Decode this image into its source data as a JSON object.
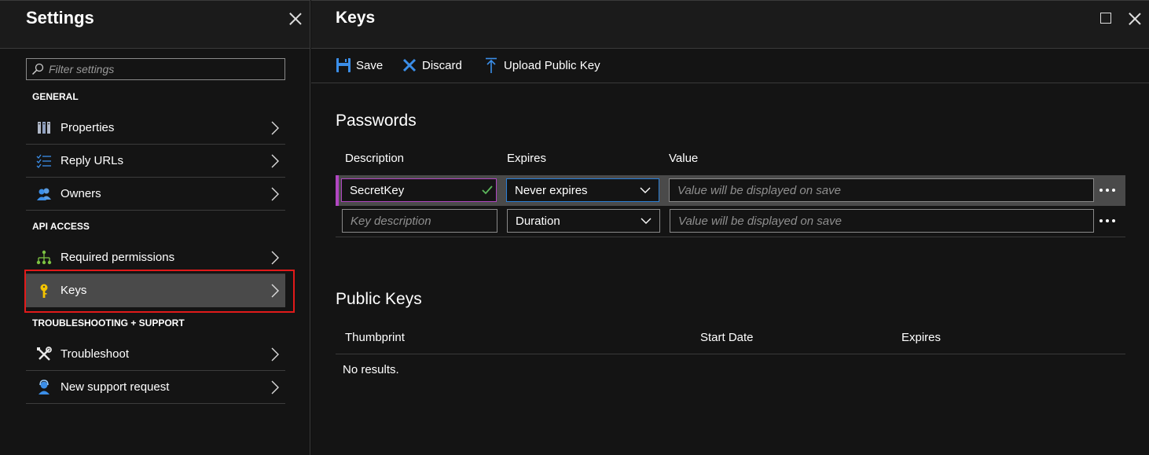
{
  "settings": {
    "title": "Settings",
    "filter_placeholder": "Filter settings",
    "sections": {
      "general": "GENERAL",
      "api_access": "API ACCESS",
      "troubleshooting": "TROUBLESHOOTING + SUPPORT"
    },
    "items": [
      {
        "label": "Properties",
        "icon": "properties-icon"
      },
      {
        "label": "Reply URLs",
        "icon": "list-icon"
      },
      {
        "label": "Owners",
        "icon": "users-icon"
      },
      {
        "label": "Required permissions",
        "icon": "hierarchy-icon"
      },
      {
        "label": "Keys",
        "icon": "key-icon",
        "selected": true
      },
      {
        "label": "Troubleshoot",
        "icon": "tools-icon"
      },
      {
        "label": "New support request",
        "icon": "support-person-icon"
      }
    ]
  },
  "keys": {
    "title": "Keys",
    "toolbar": {
      "save": "Save",
      "discard": "Discard",
      "upload": "Upload Public Key"
    },
    "passwords": {
      "title": "Passwords",
      "columns": [
        "Description",
        "Expires",
        "Value"
      ],
      "rows": [
        {
          "description": "SecretKey",
          "expires": "Never expires",
          "value_placeholder": "Value will be displayed on save"
        },
        {
          "description_placeholder": "Key description",
          "expires": "Duration",
          "value_placeholder": "Value will be displayed on save"
        }
      ]
    },
    "public_keys": {
      "title": "Public Keys",
      "columns": [
        "Thumbprint",
        "Start Date",
        "Expires"
      ],
      "empty": "No results."
    }
  },
  "colors": {
    "accent_purple": "#b146c2",
    "focus_blue": "#2a7fd8",
    "highlight_red": "#e11a1a",
    "icon_blue": "#3b8ee8",
    "key_yellow": "#f5c400",
    "check_green": "#5cb85c"
  }
}
